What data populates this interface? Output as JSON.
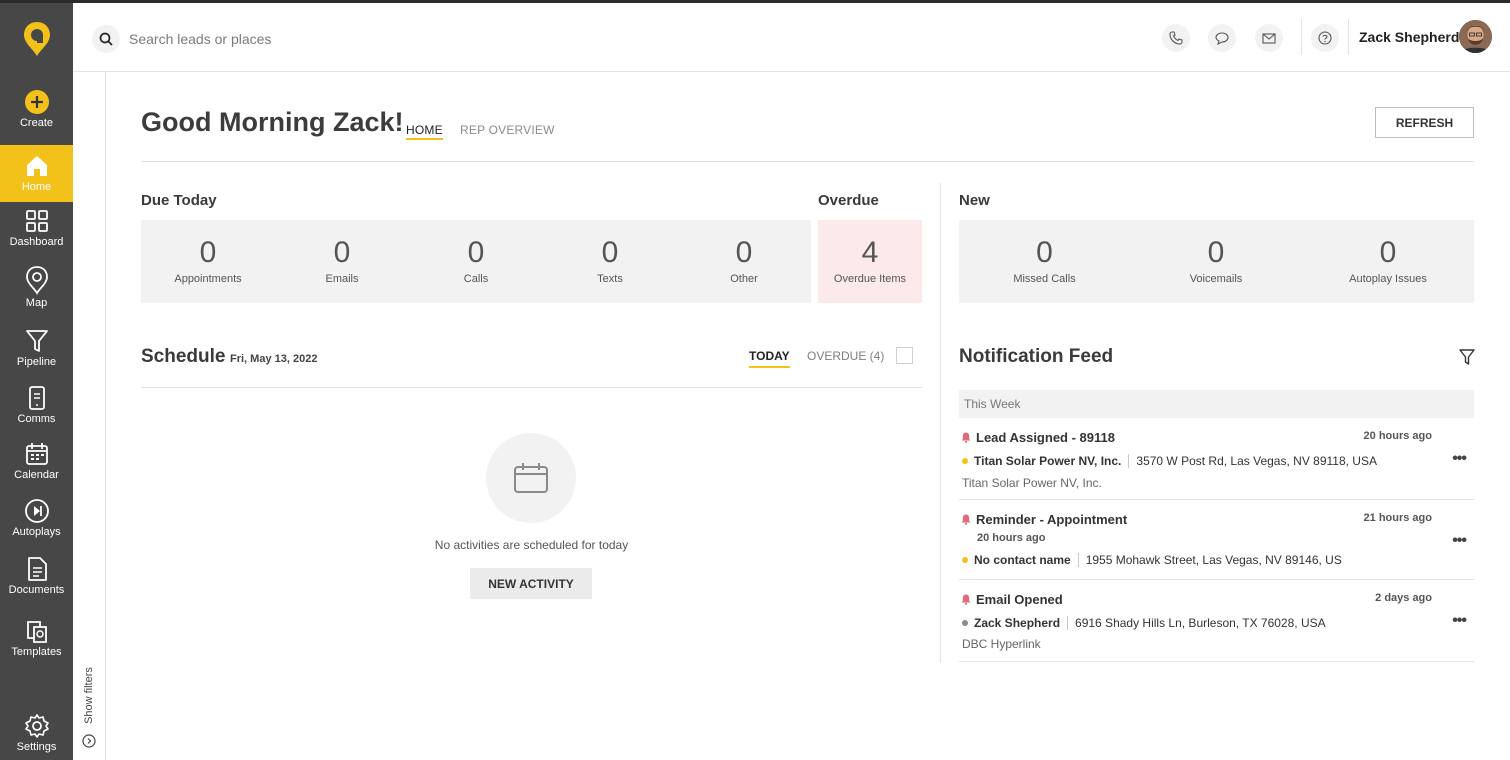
{
  "sidebar": {
    "items": [
      {
        "label": "Create",
        "icon": "plus-circle-icon"
      },
      {
        "label": "Home",
        "icon": "home-icon",
        "active": true
      },
      {
        "label": "Dashboard",
        "icon": "grid-icon"
      },
      {
        "label": "Map",
        "icon": "map-pin-icon"
      },
      {
        "label": "Pipeline",
        "icon": "funnel-icon"
      },
      {
        "label": "Comms",
        "icon": "phone-chat-icon"
      },
      {
        "label": "Calendar",
        "icon": "calendar-icon"
      },
      {
        "label": "Autoplays",
        "icon": "skip-forward-icon"
      },
      {
        "label": "Documents",
        "icon": "document-icon"
      },
      {
        "label": "Templates",
        "icon": "templates-icon"
      },
      {
        "label": "Settings",
        "icon": "gear-icon"
      }
    ],
    "show_filters": "Show filters"
  },
  "topbar": {
    "search_placeholder": "Search leads or places",
    "user_name": "Zack Shepherd"
  },
  "header": {
    "greeting": "Good Morning Zack!",
    "tabs": [
      {
        "label": "HOME",
        "active": true
      },
      {
        "label": "REP OVERVIEW",
        "active": false
      }
    ],
    "refresh_label": "REFRESH"
  },
  "due_today": {
    "title": "Due Today",
    "stats": [
      {
        "value": "0",
        "label": "Appointments"
      },
      {
        "value": "0",
        "label": "Emails"
      },
      {
        "value": "0",
        "label": "Calls"
      },
      {
        "value": "0",
        "label": "Texts"
      },
      {
        "value": "0",
        "label": "Other"
      }
    ]
  },
  "overdue": {
    "title": "Overdue",
    "value": "4",
    "label": "Overdue Items"
  },
  "new": {
    "title": "New",
    "stats": [
      {
        "value": "0",
        "label": "Missed Calls"
      },
      {
        "value": "0",
        "label": "Voicemails"
      },
      {
        "value": "0",
        "label": "Autoplay Issues"
      }
    ]
  },
  "schedule": {
    "title": "Schedule",
    "date": "Fri, May 13, 2022",
    "tabs": [
      {
        "label": "TODAY",
        "active": true
      },
      {
        "label": "OVERDUE (4)",
        "active": false
      }
    ],
    "empty_text": "No activities are scheduled for today",
    "new_activity_label": "NEW ACTIVITY"
  },
  "notifications": {
    "title": "Notification Feed",
    "group_label": "This Week",
    "items": [
      {
        "title": "Lead Assigned - 89118",
        "time": "20 hours ago",
        "contact": "Titan Solar Power NV, Inc.",
        "contact_dot_color": "#f2c21b",
        "address": "3570 W Post Rd, Las Vegas, NV 89118, USA",
        "sub": "Titan Solar Power NV, Inc."
      },
      {
        "title": "Reminder - Appointment",
        "time": "21 hours ago",
        "subtime": "20 hours ago",
        "contact": "No contact name",
        "contact_dot_color": "#f2c21b",
        "address": "1955 Mohawk Street, Las Vegas, NV 89146, US"
      },
      {
        "title": "Email Opened",
        "time": "2 days ago",
        "contact": "Zack Shepherd",
        "contact_dot_color": "#8a8a8a",
        "address": "6916 Shady Hills Ln, Burleson, TX 76028, USA",
        "sub": "DBC Hyperlink"
      }
    ]
  },
  "colors": {
    "accent": "#f2c21b",
    "sidebar": "#474747",
    "overdue_bg": "#fceaea",
    "bell": "#e06a78"
  }
}
